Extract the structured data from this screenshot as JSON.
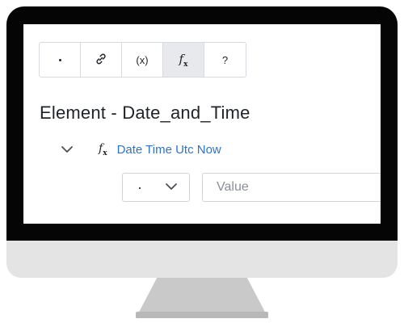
{
  "toolbar": {
    "buttons": [
      {
        "name": "dot",
        "label": "·"
      },
      {
        "name": "link",
        "label": ""
      },
      {
        "name": "variable",
        "label": "(x)"
      },
      {
        "name": "function",
        "label": "fx",
        "active": true
      },
      {
        "name": "help",
        "label": "?"
      }
    ]
  },
  "icons": {
    "dot": "dot-icon",
    "link": "link-icon",
    "function": "function-icon",
    "chevron": "chevron-down-icon"
  },
  "element": {
    "title": "Element - Date_and_Time",
    "function_name": "Date Time Utc Now",
    "operator_value": "·",
    "value_placeholder": "Value"
  },
  "colors": {
    "link": "#2f73c9",
    "bezel": "#050505",
    "chin": "#e4e4e4",
    "stand": "#c9c9c9",
    "active_button": "#e7e9ec"
  }
}
